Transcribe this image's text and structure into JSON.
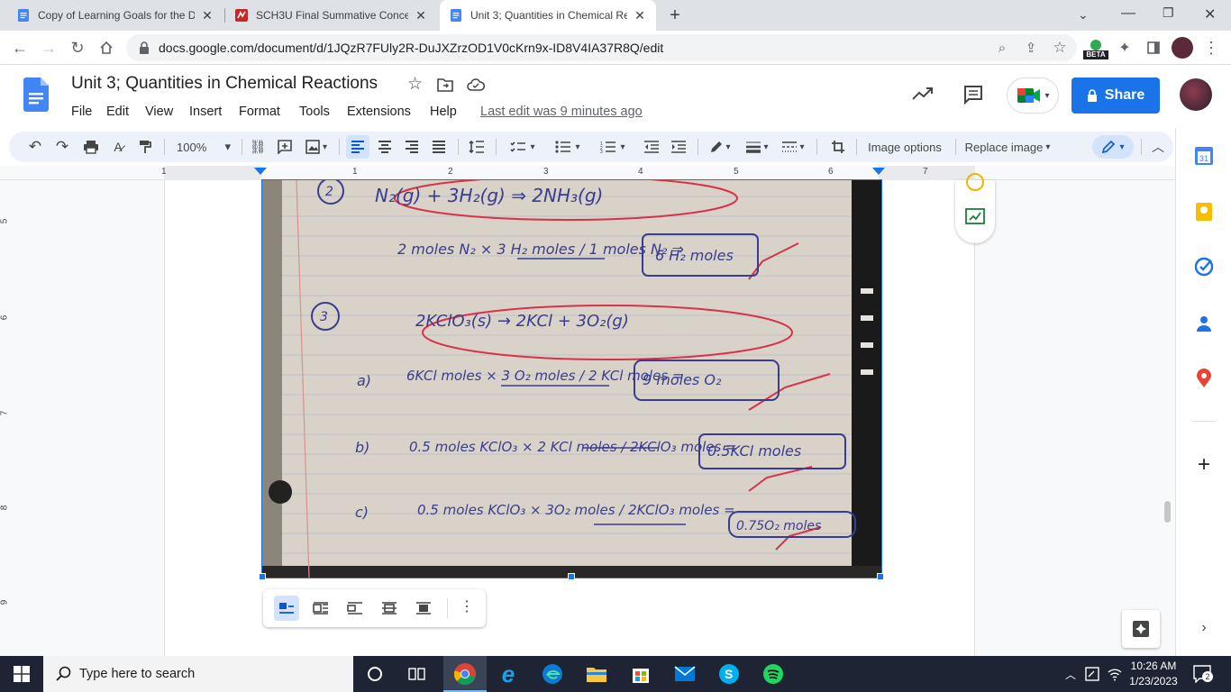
{
  "browser": {
    "tabs": [
      {
        "title": "Copy of Learning Goals for the D",
        "active": false
      },
      {
        "title": "SCH3U Final Summative Concept",
        "active": false
      },
      {
        "title": "Unit 3; Quantities in Chemical Re",
        "active": true
      }
    ],
    "url": "docs.google.com/document/d/1JQzR7FUly2R-DuJXZrzOD1V0cKrn9x-ID8V4IA37R8Q/edit",
    "beta_label": "BETA"
  },
  "docs": {
    "title": "Unit 3; Quantities in Chemical Reactions",
    "menus": [
      "File",
      "Edit",
      "View",
      "Insert",
      "Format",
      "Tools",
      "Extensions",
      "Help"
    ],
    "last_edit": "Last edit was 9 minutes ago",
    "share_label": "Share"
  },
  "toolbar": {
    "zoom": "100%",
    "image_options": "Image options",
    "replace_image": "Replace image"
  },
  "ruler": {
    "h": [
      "1",
      "1",
      "2",
      "3",
      "4",
      "5",
      "6",
      "7"
    ],
    "v": [
      "5",
      "6",
      "7",
      "8",
      "9"
    ]
  },
  "notes": {
    "q2_reaction": "N₂(g) + 3H₂(g) ⇒ 2NH₃(g)",
    "q2_work": "2 moles N₂ × 3 H₂ moles / 1 moles N₂ ⇒",
    "q2_answer": "6 H₂ moles",
    "q3_reaction": "2KClO₃(s) → 2KCl + 3O₂(g)",
    "qa_label": "a)",
    "qa_work": "6KCl moles × 3 O₂ moles / 2 KCl moles =",
    "qa_answer": "9 moles O₂",
    "qb_label": "b)",
    "qb_work": "0.5 moles KClO₃ × 2 KCl moles / 2KClO₃ moles =",
    "qb_answer": "0.5KCl moles",
    "qc_label": "c)",
    "qc_work": "0.5 moles KClO₃ × 3O₂ moles / 2KClO₃ moles =",
    "qc_answer": "0.75O₂ moles"
  },
  "taskbar": {
    "search_placeholder": "Type here to search",
    "time": "10:26 AM",
    "date": "1/23/2023",
    "notifications": "2"
  },
  "colors": {
    "accent": "#1a73e8",
    "taskbar": "#1e2433",
    "toolbar_bg": "#edf2fa"
  }
}
